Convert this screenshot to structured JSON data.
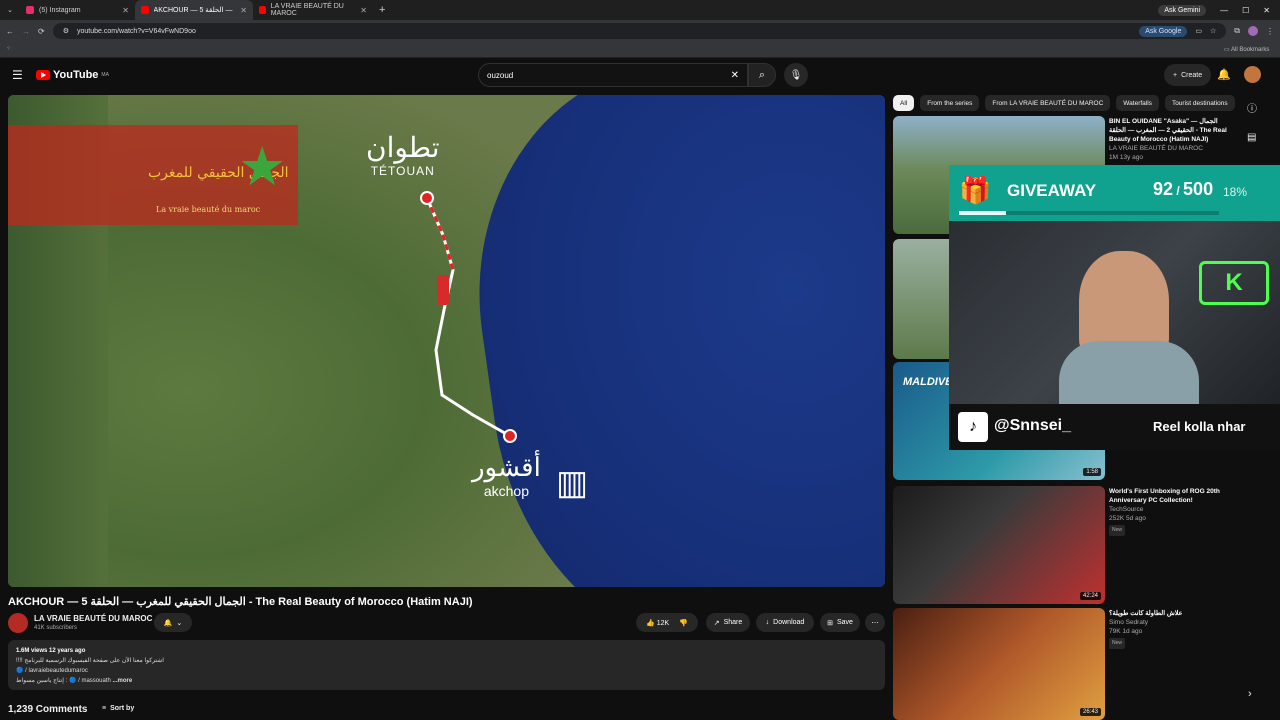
{
  "browser": {
    "tabs": [
      {
        "label": "(5) Instagram",
        "color": "#e1306c"
      },
      {
        "label": "AKCHOUR — 5 الحلقة — ...",
        "color": "#ff0000"
      },
      {
        "label": "LA VRAIE BEAUTÉ DU MAROC",
        "color": "#ff0000"
      }
    ],
    "url": "youtube.com/watch?v=V64vFwND9oo",
    "ask_google": "Ask Google",
    "ask_gemini": "Ask Gemini",
    "all_bookmarks": "All Bookmarks"
  },
  "header": {
    "logo": "YouTube",
    "logo_sup": "MA",
    "search_value": "ouzoud",
    "create_label": "Create"
  },
  "video": {
    "banner_arabic": "الجمال الحقيقي للمغرب",
    "banner_latin": "La vraie beauté du maroc",
    "city1_ar": "تطوان",
    "city1_lat": "TÉTOUAN",
    "city2_ar": "أقشور",
    "city2_lat": "akchop",
    "title": "AKCHOUR — 5 الجمال الحقيقي للمغرب — الحلقة - The Real Beauty of Morocco (Hatim NAJI)"
  },
  "channel": {
    "name": "LA VRAIE BEAUTÉ DU MAROC",
    "subs": "41K subscribers"
  },
  "actions": {
    "likes": "12K",
    "share": "Share",
    "download": "Download",
    "save": "Save"
  },
  "description": {
    "stats": "1.6M views  12 years ago",
    "line1": "!!!! اشتركوا معنا الآن على صفحة الفيسبوك الرسمية للبرنامج",
    "line2": "lavraiebeautedumaroc",
    "line3": "إنتاج ياسين مسواط :",
    "tag": "massouath",
    "more": "...more"
  },
  "comments": {
    "count": "1,239 Comments",
    "sort": "Sort by"
  },
  "chips": [
    "All",
    "From the series",
    "From LA VRAIE BEAUTÉ DU MAROC",
    "Waterfalls",
    "Tourist destinations"
  ],
  "sidebar": [
    {
      "title": "BIN EL OUIDANE \"Asaka\" — الجمال الحقيقي 2 — المغرب — الحلقة - The Real Beauty of Morocco (Hatim NAJI)",
      "channel": "LA VRAIE BEAUTÉ DU MAROC",
      "meta": "1M  13y ago",
      "duration": ""
    },
    {
      "title": "",
      "channel": "",
      "meta": "",
      "duration": ""
    },
    {
      "title": "",
      "channel": "",
      "meta": "",
      "duration": "1:58"
    },
    {
      "title": "World's First Unboxing of ROG 20th Anniversary PC Collection!",
      "channel": "TechSource",
      "meta": "252K  5d ago",
      "badge": "New",
      "duration": "42:24"
    },
    {
      "title": "علاش الطاولة كانت طويلة؟",
      "channel": "Simo Sedraty",
      "meta": "79K  1d ago",
      "badge": "New",
      "duration": "26:43"
    }
  ],
  "overlay": {
    "giveaway_label": "GIVEAWAY",
    "count": "92",
    "total": "500",
    "percent": "18%",
    "progress": 0.18,
    "tiktok_handle": "@Snnsei_",
    "tiktok_text": "Reel kolla nhar",
    "thumb3_text": "MALDIVES"
  }
}
